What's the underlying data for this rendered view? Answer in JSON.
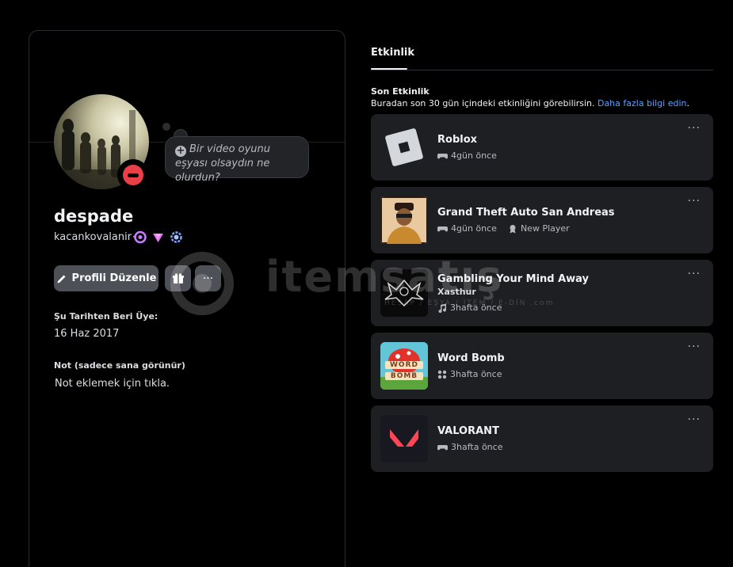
{
  "profile": {
    "thought_text": "Bir video oyunu eşyası olsaydın ne olurdun?",
    "display_name": "despade",
    "username": "kacankovalanir",
    "edit_button_label": "Profili Düzenle",
    "member_since_label": "Şu Tarihten Beri Üye:",
    "member_since_value": "16 Haz 2017",
    "note_label": "Not (sadece sana görünür)",
    "note_placeholder": "Not eklemek için tıkla."
  },
  "activity_tab": {
    "label": "Etkinlik",
    "recent_title": "Son Etkinlik",
    "recent_desc": "Buradan son 30 gün içindeki etkinliğini görebilirsin.",
    "recent_link": "Daha fazla bilgi edin",
    "recent_period": "."
  },
  "activities": [
    {
      "name": "Roblox",
      "time": "4gün önce",
      "icon": "gamepad-icon"
    },
    {
      "name": "Grand Theft Auto San Andreas",
      "time": "4gün önce",
      "icon": "gamepad-icon",
      "extra": "New Player",
      "extra_icon": "achievement-icon"
    },
    {
      "name": "Gambling Your Mind Away",
      "artist": "Xasthur",
      "time": "3hafta önce",
      "icon": "music-note-icon",
      "art_caption": "Xasthur"
    },
    {
      "name": "Word Bomb",
      "time": "3hafta önce",
      "icon": "activity-icon",
      "art_text_top": "WORD",
      "art_text_bottom": "BOMB"
    },
    {
      "name": "VALORANT",
      "time": "3hafta önce",
      "icon": "gamepad-icon"
    }
  ],
  "watermark": {
    "text": "itemsatış",
    "sub": "HESAP / EŞYA / İTEM / E-DİN .com"
  },
  "colors": {
    "background": "#000000",
    "card": "#1e1f22",
    "button": "#4e5058",
    "link": "#5ea0ff",
    "dnd": "#ea3f47"
  }
}
